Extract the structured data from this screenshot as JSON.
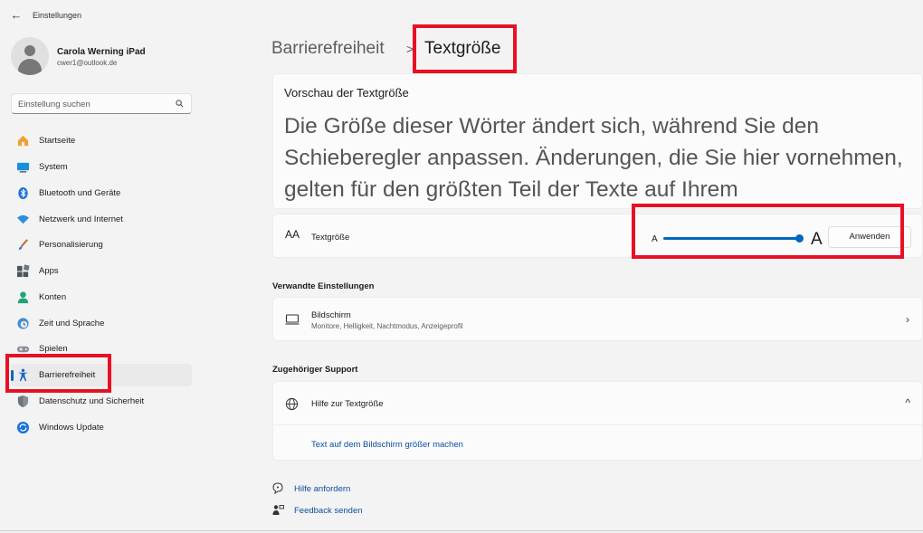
{
  "window": {
    "title": "Einstellungen"
  },
  "profile": {
    "name": "Carola Werning iPad",
    "email": "cwer1@outlook.de"
  },
  "search": {
    "placeholder": "Einstellung suchen"
  },
  "sidebar": {
    "items": [
      {
        "label": "Startseite",
        "icon": "home-icon"
      },
      {
        "label": "System",
        "icon": "system-icon"
      },
      {
        "label": "Bluetooth und Geräte",
        "icon": "bluetooth-icon"
      },
      {
        "label": "Netzwerk und Internet",
        "icon": "wifi-icon"
      },
      {
        "label": "Personalisierung",
        "icon": "brush-icon"
      },
      {
        "label": "Apps",
        "icon": "apps-icon"
      },
      {
        "label": "Konten",
        "icon": "account-icon"
      },
      {
        "label": "Zeit und Sprache",
        "icon": "clock-globe-icon"
      },
      {
        "label": "Spielen",
        "icon": "gamepad-icon"
      },
      {
        "label": "Barrierefreiheit",
        "icon": "accessibility-icon",
        "selected": true
      },
      {
        "label": "Datenschutz und Sicherheit",
        "icon": "shield-icon"
      },
      {
        "label": "Windows Update",
        "icon": "update-icon"
      }
    ]
  },
  "breadcrumb": {
    "parent": "Barrierefreiheit",
    "separator": ">",
    "current": "Textgröße"
  },
  "preview": {
    "title": "Vorschau der Textgröße",
    "text": "Die Größe dieser Wörter ändert sich, während Sie den Schieberegler anpassen. Änderungen, die Sie hier vornehmen, gelten für den größten Teil der Texte auf Ihrem"
  },
  "text_size": {
    "icon_text": "AA",
    "label": "Textgröße",
    "slider_min_label": "A",
    "slider_max_label": "A",
    "apply_label": "Anwenden"
  },
  "related": {
    "heading": "Verwandte Einstellungen",
    "display_title": "Bildschirm",
    "display_subtitle": "Monitore, Helligkeit, Nachtmodus, Anzeigeprofil"
  },
  "support": {
    "heading": "Zugehöriger Support",
    "help_title": "Hilfe zur Textgröße",
    "help_link": "Text auf dem Bildschirm größer machen"
  },
  "footer": {
    "get_help": "Hilfe anfordern",
    "feedback": "Feedback senden"
  },
  "colors": {
    "accent": "#0067c0",
    "annotation": "#e81123"
  }
}
